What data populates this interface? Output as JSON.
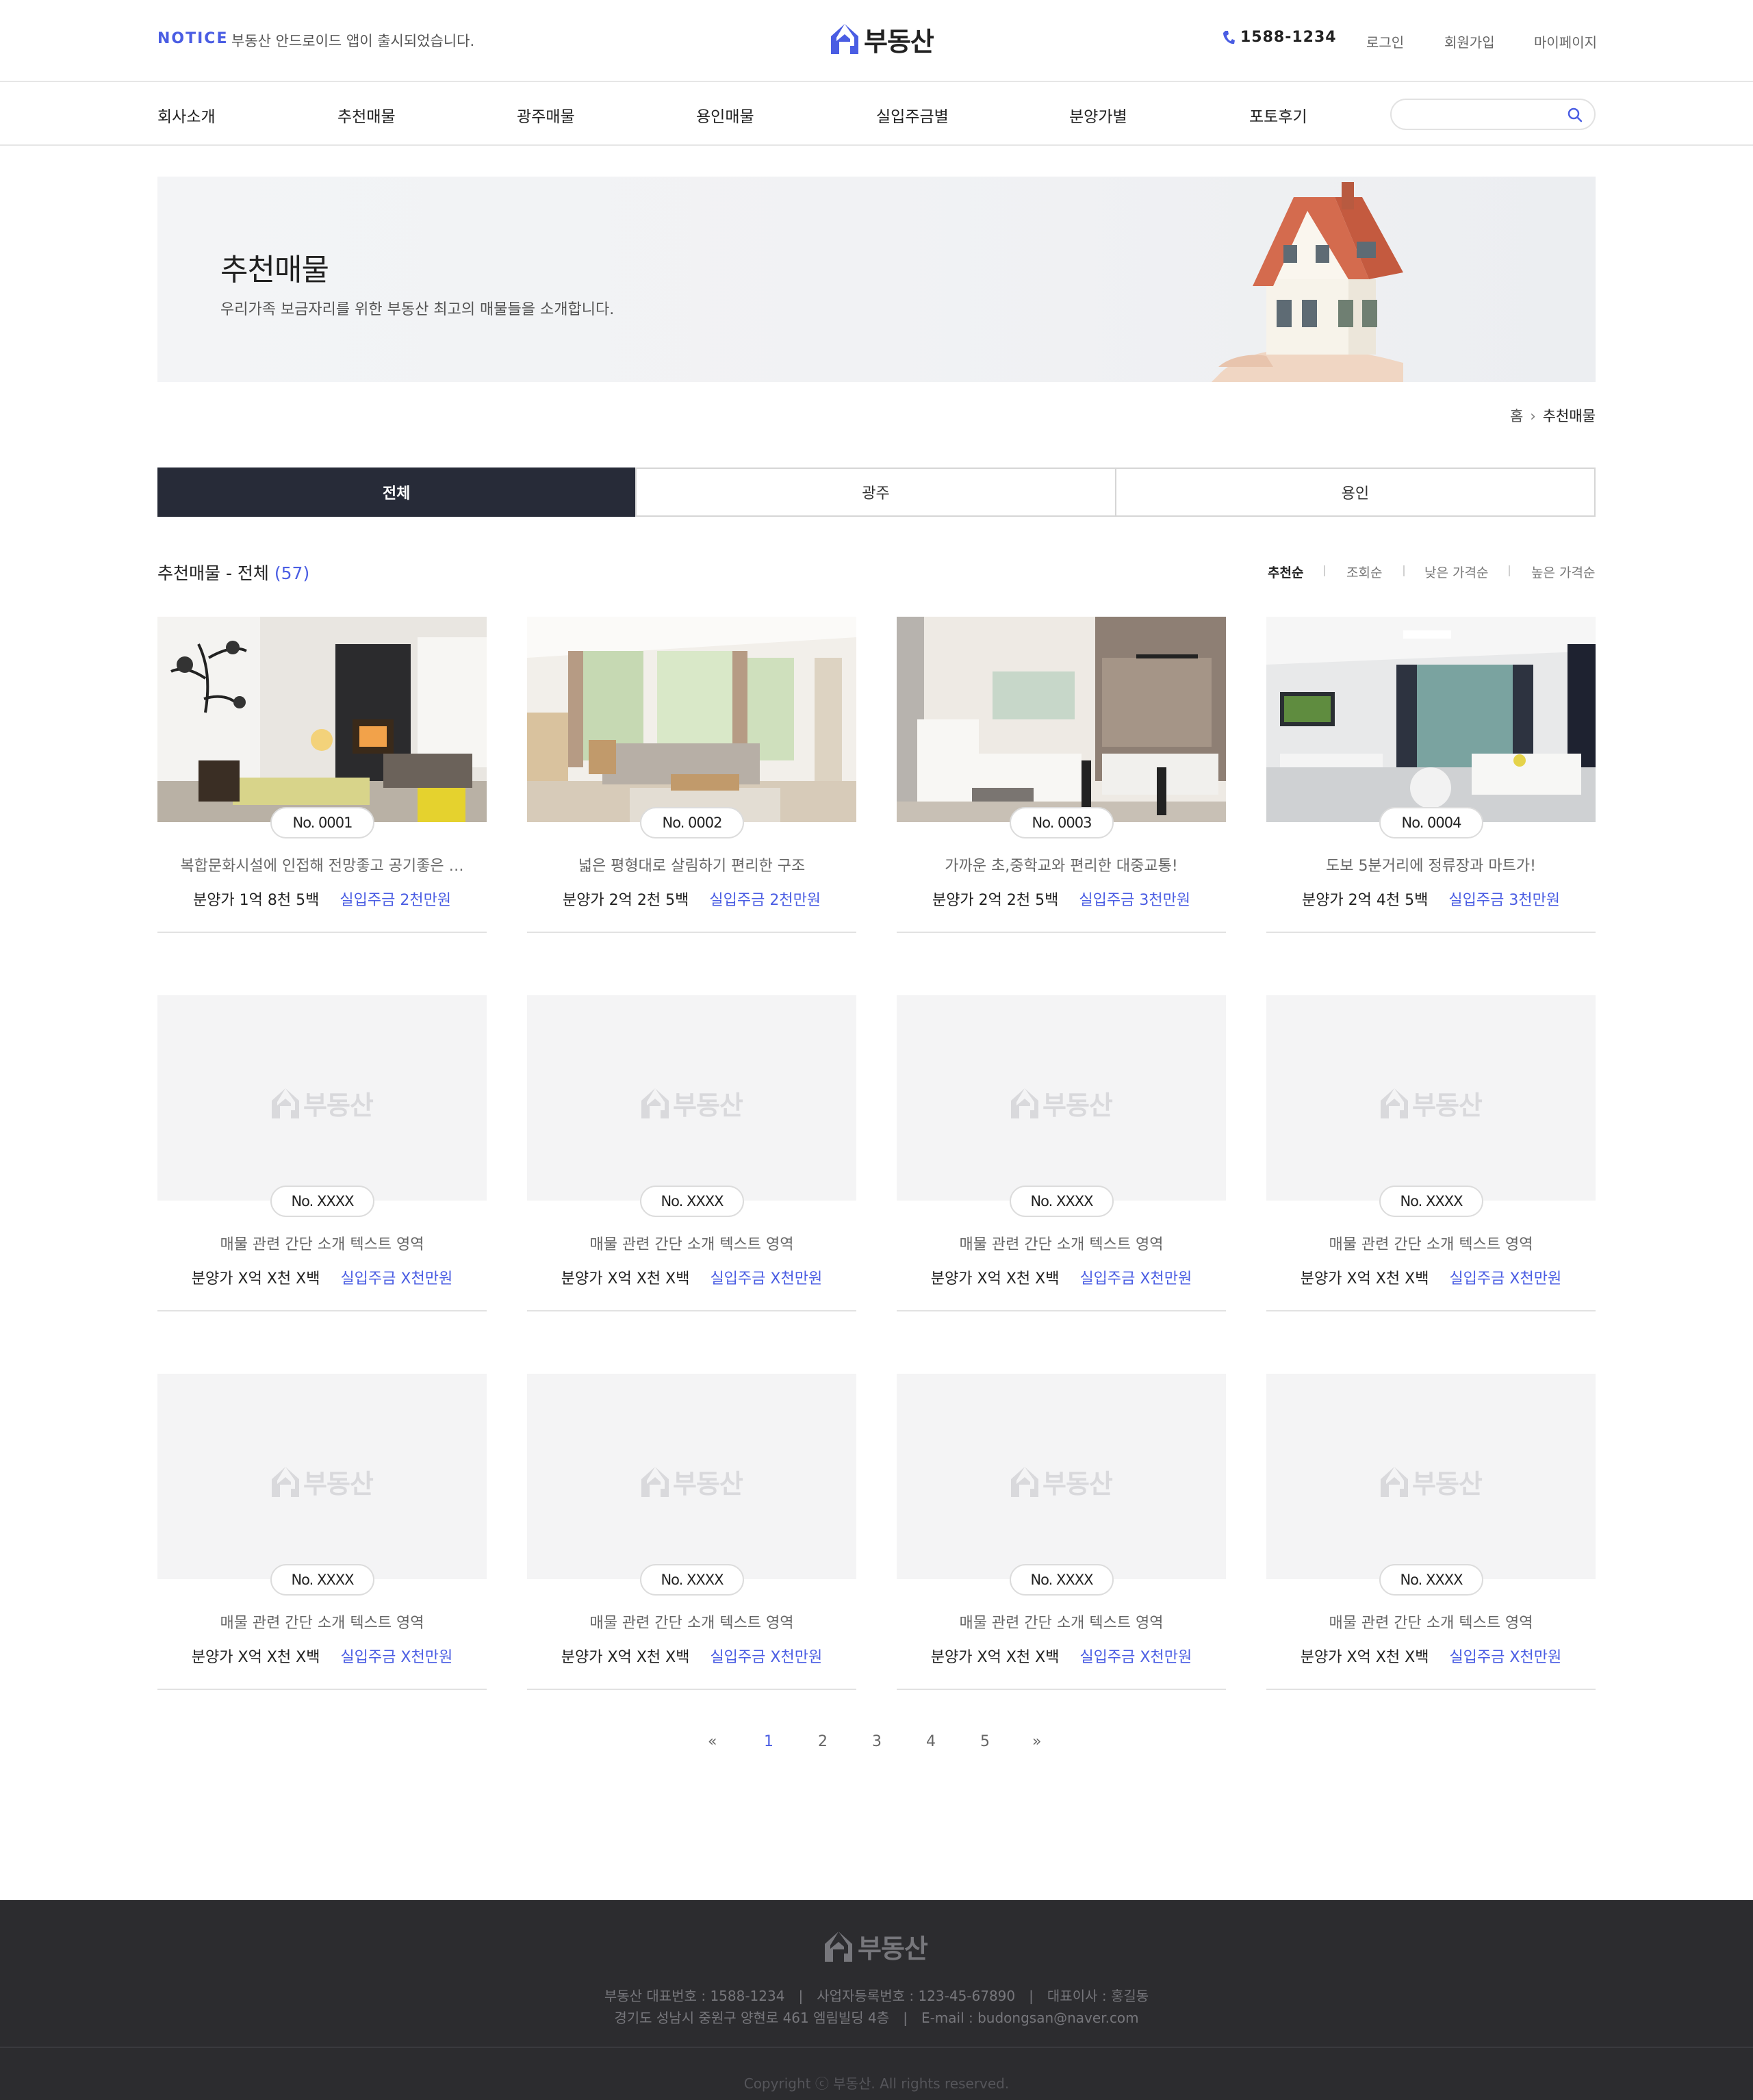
{
  "header": {
    "notice_label": "NOTICE",
    "notice_text": "부동산 안드로이드 앱이 출시되었습니다.",
    "logo_text": "부동산",
    "phone": "1588-1234",
    "login": "로그인",
    "signup": "회원가입",
    "mypage": "마이페이지"
  },
  "nav": {
    "items": [
      "회사소개",
      "추천매물",
      "광주매물",
      "용인매물",
      "실입주금별",
      "분양가별",
      "포토후기"
    ],
    "search_placeholder": ""
  },
  "banner": {
    "title": "추천매물",
    "description": "우리가족 보금자리를 위한 부동산 최고의 매물들을 소개합니다."
  },
  "breadcrumb": {
    "home": "홈",
    "current": "추천매물"
  },
  "tabs": [
    {
      "label": "전체",
      "active": true
    },
    {
      "label": "광주",
      "active": false
    },
    {
      "label": "용인",
      "active": false
    }
  ],
  "list": {
    "heading": "추천매물 - 전체",
    "count": "(57)",
    "sort": [
      "추천순",
      "조회순",
      "낮은 가격순",
      "높은 가격순"
    ],
    "sort_active": "추천순"
  },
  "cards": [
    {
      "no": "No. 0001",
      "desc": "복합문화시설에 인접해 전망좋고 공기좋은 …",
      "sale": "분양가 1억 8천 5백",
      "deposit": "실입주금 2천만원",
      "image": "living-room-fireplace"
    },
    {
      "no": "No. 0002",
      "desc": "넓은 평형대로 살림하기 편리한 구조",
      "sale": "분양가 2억 2천 5백",
      "deposit": "실입주금 2천만원",
      "image": "living-room-sofa-window"
    },
    {
      "no": "No. 0003",
      "desc": "가까운 초,중학교와 편리한 대중교통!",
      "sale": "분양가 2억 2천 5백",
      "deposit": "실입주금 3천만원",
      "image": "living-room-kitchen"
    },
    {
      "no": "No. 0004",
      "desc": "도보 5분거리에 정류장과 마트가!",
      "sale": "분양가 2억 4천 5백",
      "deposit": "실입주금 3천만원",
      "image": "living-room-tv"
    },
    {
      "no": "No. XXXX",
      "desc": "매물 관련 간단 소개 텍스트 영역",
      "sale": "분양가 X억 X천 X백",
      "deposit": "실입주금 X천만원",
      "image": "placeholder"
    },
    {
      "no": "No. XXXX",
      "desc": "매물 관련 간단 소개 텍스트 영역",
      "sale": "분양가 X억 X천 X백",
      "deposit": "실입주금 X천만원",
      "image": "placeholder"
    },
    {
      "no": "No. XXXX",
      "desc": "매물 관련 간단 소개 텍스트 영역",
      "sale": "분양가 X억 X천 X백",
      "deposit": "실입주금 X천만원",
      "image": "placeholder"
    },
    {
      "no": "No. XXXX",
      "desc": "매물 관련 간단 소개 텍스트 영역",
      "sale": "분양가 X억 X천 X백",
      "deposit": "실입주금 X천만원",
      "image": "placeholder"
    },
    {
      "no": "No. XXXX",
      "desc": "매물 관련 간단 소개 텍스트 영역",
      "sale": "분양가 X억 X천 X백",
      "deposit": "실입주금 X천만원",
      "image": "placeholder"
    },
    {
      "no": "No. XXXX",
      "desc": "매물 관련 간단 소개 텍스트 영역",
      "sale": "분양가 X억 X천 X백",
      "deposit": "실입주금 X천만원",
      "image": "placeholder"
    },
    {
      "no": "No. XXXX",
      "desc": "매물 관련 간단 소개 텍스트 영역",
      "sale": "분양가 X억 X천 X백",
      "deposit": "실입주금 X천만원",
      "image": "placeholder"
    },
    {
      "no": "No. XXXX",
      "desc": "매물 관련 간단 소개 텍스트 영역",
      "sale": "분양가 X억 X천 X백",
      "deposit": "실입주금 X천만원",
      "image": "placeholder"
    }
  ],
  "pagination": {
    "prev": "«",
    "pages": [
      "1",
      "2",
      "3",
      "4",
      "5"
    ],
    "current": "1",
    "next": "»"
  },
  "footer": {
    "logo_text": "부동산",
    "rep_phone": "부동산 대표번호 : 1588-1234",
    "biz_no": "사업자등록번호 : 123-45-67890",
    "ceo": "대표이사 : 홍길동",
    "address": "경기도 성남시 중원구 양현로 461 엠림빌딩 4층",
    "email": "E-mail : budongsan@naver.com",
    "copyright": "Copyright ⓒ 부동산. All rights reserved."
  },
  "colors": {
    "accent": "#4a5de3",
    "tab_active_bg": "#272b38",
    "footer_bg": "#2c2c2f"
  }
}
